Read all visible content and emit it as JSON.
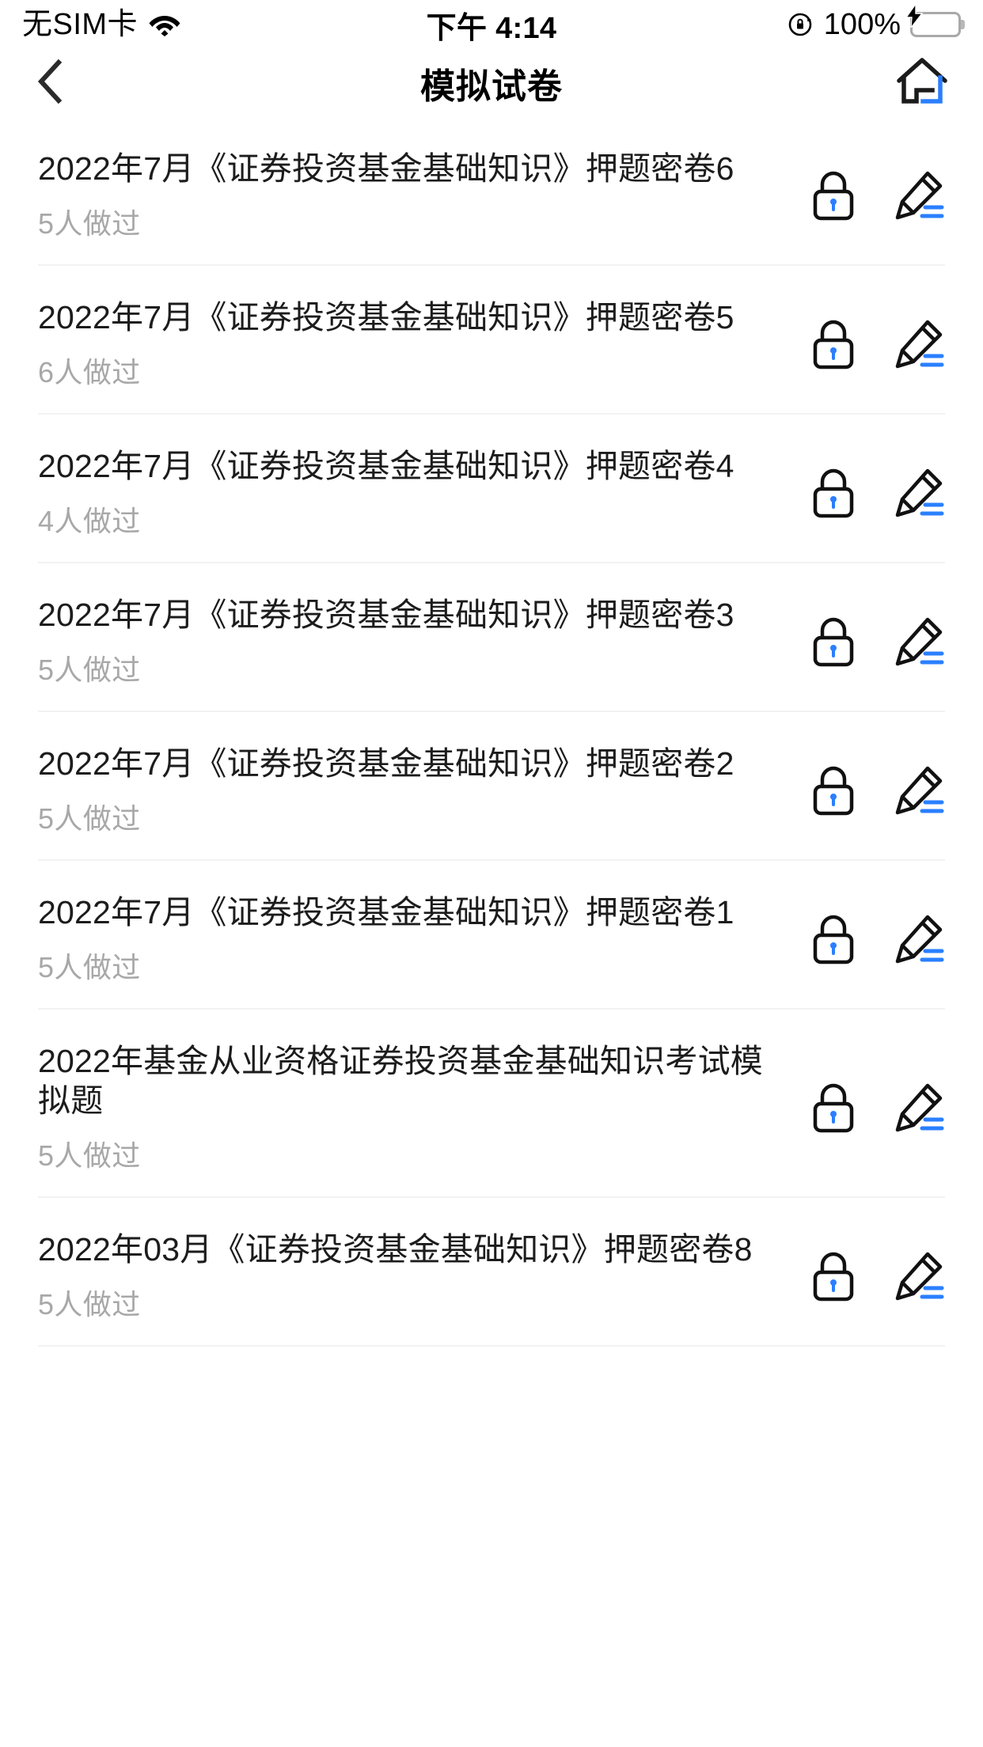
{
  "status_bar": {
    "carrier": "无SIM卡",
    "wifi_icon": "wifi-icon",
    "time": "下午 4:14",
    "rotation_lock_icon": "rotation-lock-icon",
    "battery_percent": "100%",
    "battery_icon": "battery-charging-icon",
    "battery_color": "#34c759"
  },
  "nav_bar": {
    "back_icon": "chevron-left-icon",
    "title": "模拟试卷",
    "home_icon": "home-icon",
    "home_accent_color": "#2a7fff"
  },
  "theme": {
    "accent": "#2a7fff",
    "title_color": "#1c1c1c",
    "muted_color": "#a8a8a8",
    "divider_color": "#f2f2f2"
  },
  "papers": [
    {
      "title": "2022年7月《证券投资基金基础知识》押题密卷6",
      "count": "5人做过",
      "lock_icon": "lock-icon",
      "edit_icon": "pencil-icon"
    },
    {
      "title": "2022年7月《证券投资基金基础知识》押题密卷5",
      "count": "6人做过",
      "lock_icon": "lock-icon",
      "edit_icon": "pencil-icon"
    },
    {
      "title": "2022年7月《证券投资基金基础知识》押题密卷4",
      "count": "4人做过",
      "lock_icon": "lock-icon",
      "edit_icon": "pencil-icon"
    },
    {
      "title": "2022年7月《证券投资基金基础知识》押题密卷3",
      "count": "5人做过",
      "lock_icon": "lock-icon",
      "edit_icon": "pencil-icon"
    },
    {
      "title": "2022年7月《证券投资基金基础知识》押题密卷2",
      "count": "5人做过",
      "lock_icon": "lock-icon",
      "edit_icon": "pencil-icon"
    },
    {
      "title": "2022年7月《证券投资基金基础知识》押题密卷1",
      "count": "5人做过",
      "lock_icon": "lock-icon",
      "edit_icon": "pencil-icon"
    },
    {
      "title": "2022年基金从业资格证券投资基金基础知识考试模拟题",
      "count": "5人做过",
      "lock_icon": "lock-icon",
      "edit_icon": "pencil-icon"
    },
    {
      "title": "2022年03月《证券投资基金基础知识》押题密卷8",
      "count": "5人做过",
      "lock_icon": "lock-icon",
      "edit_icon": "pencil-icon"
    }
  ]
}
